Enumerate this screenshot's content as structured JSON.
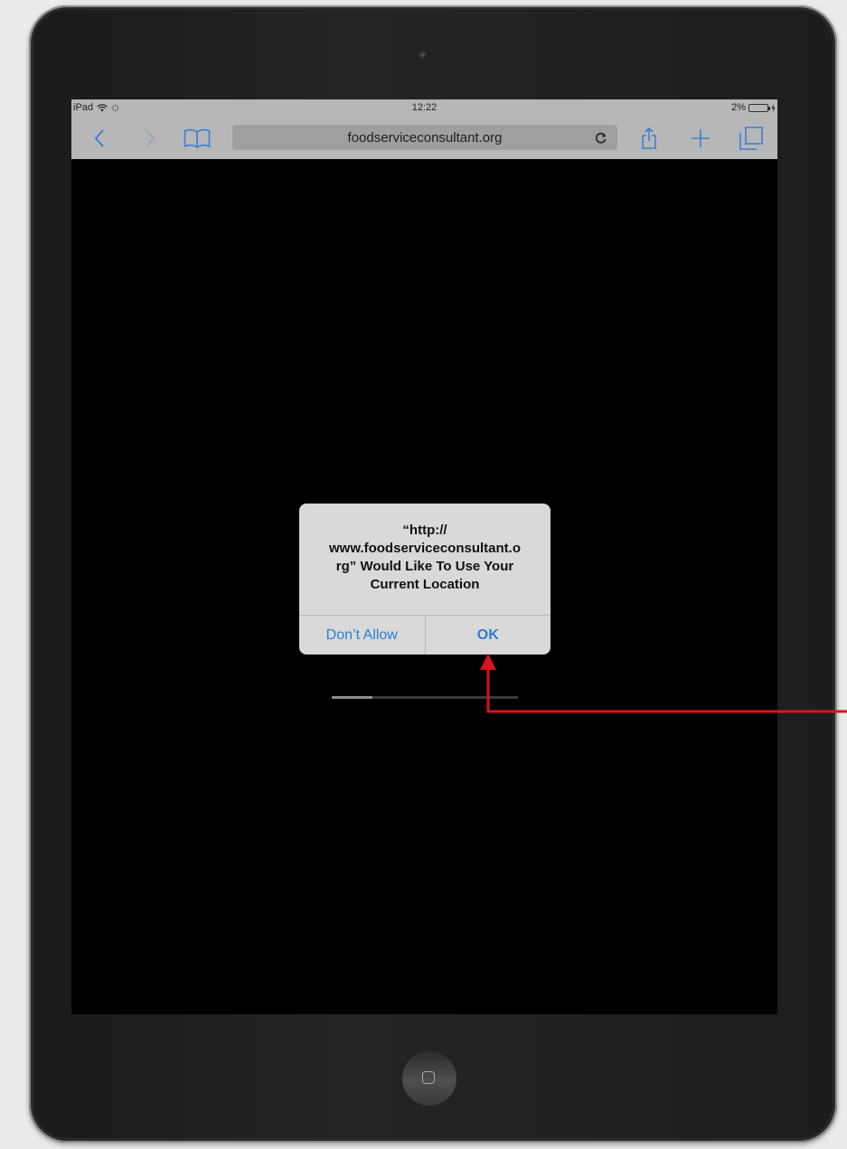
{
  "status_bar": {
    "device": "iPad",
    "time": "12:22",
    "battery_percent": "2%",
    "battery_level": 0.02
  },
  "browser": {
    "url": "foodserviceconsultant.org",
    "icons": {
      "back": "chevron-left-icon",
      "forward": "chevron-right-icon",
      "bookmarks": "book-icon",
      "reload": "reload-icon",
      "share": "share-icon",
      "new_tab": "plus-icon",
      "tabs": "tabs-icon"
    }
  },
  "dialog": {
    "title": "“http://\nwww.foodserviceconsultant.o\nrg” Would Like To Use Your\nCurrent Location",
    "buttons": {
      "deny": "Don’t Allow",
      "ok": "OK"
    }
  },
  "page_load_progress": 0.22,
  "colors": {
    "accent": "#2f7bd3",
    "annotation_arrow": "#d9141a",
    "toolbar": "#b7b7b7",
    "screen": "#000000"
  }
}
